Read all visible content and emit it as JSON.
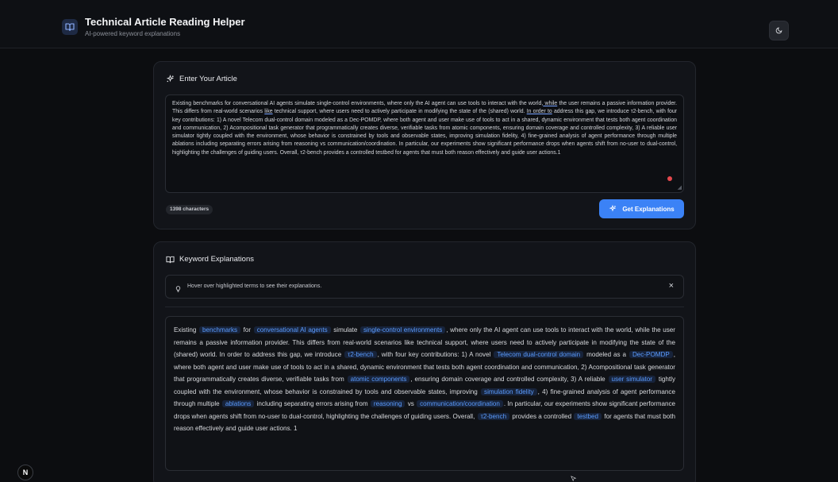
{
  "header": {
    "title": "Technical Article Reading Helper",
    "subtitle": "AI-powered keyword explanations",
    "logo_icon": "book-open-icon",
    "theme_icon": "moon-icon"
  },
  "input_card": {
    "title": "Enter Your Article",
    "title_icon": "sparkles-icon",
    "article": {
      "seg0": "Existing benchmarks for conversational AI agents simulate single-control environments, where only the AI agent can use tools to interact with the world,",
      "ul1": " while",
      "seg1": " the user remains a passive information provider. This differs from real-world scenarios ",
      "ul2": "like",
      "seg2": " technical support, where users need to actively participate in modifying the state of the (shared) world. ",
      "ul3": "In order to",
      "seg3": " address this gap, we introduce τ2-bench, with four key contributions: 1) A novel Telecom dual-control domain modeled as a Dec-POMDP, where both agent and user make use of tools to act in a shared, dynamic environment that tests both agent coordination and communication, 2) Acompositional task generator that programmatically creates diverse, verifiable tasks from atomic components, ensuring domain coverage and controlled complexity, 3) A reliable user simulator tightly coupled with the environment, whose behavior is constrained by tools and observable states, improving simulation fidelity, 4) fine-grained analysis of agent performance through multiple ablations including separating errors arising from reasoning vs communication/coordination. In particular, our experiments show significant performance drops when agents shift from no-user to dual-control, highlighting the challenges of guiding users. Overall, τ2-bench provides a controlled testbed for agents that must both reason effectively and guide user actions.1"
    },
    "char_count": "1398 characters",
    "button_label": "Get Explanations",
    "button_icon": "sparkles-icon"
  },
  "explain_card": {
    "title": "Keyword Explanations",
    "title_icon": "book-open-icon",
    "hint": "Hover over highlighted terms to see their explanations.",
    "hint_icon": "lightbulb-icon",
    "close_label": "×",
    "body": {
      "t0": "Existing",
      "k1": "benchmarks",
      "t1": "for",
      "k2": "conversational AI agents",
      "t2": "simulate",
      "k3": "single-control environments",
      "t3": ", where only the AI agent can use tools to interact with the world, while the user remains a passive information provider. This differs from real-world scenarios like technical support, where users need to actively participate in modifying the state of the (shared) world. In order to address this gap, we introduce",
      "k4": "τ2-bench",
      "t4": ", with four key contributions: 1) A novel",
      "k5": "Telecom dual-control domain",
      "t5": "modeled as a",
      "k6": "Dec-POMDP",
      "t6": ", where both agent and user make use of tools to act in a shared, dynamic environment that tests both agent coordination and communication, 2) Acompositional task generator that programmatically creates diverse, verifiable tasks from",
      "k7": "atomic components",
      "t7": ", ensuring domain coverage and controlled complexity, 3) A reliable",
      "k8": "user simulator",
      "t8": "tightly coupled with the environment, whose behavior is constrained by tools and observable states, improving",
      "k9": "simulation fidelity",
      "t9": ", 4) fine-grained analysis of agent performance through multiple",
      "k10": "ablations",
      "t10": "including separating errors arising from",
      "k11": "reasoning",
      "t11": "vs",
      "k12": "communication/coordination",
      "t12": ". In particular, our experiments show significant performance drops when agents shift from no-user to dual-control, highlighting the challenges of guiding users. Overall,",
      "k13": "τ2-bench",
      "t13": "provides a controlled",
      "k14": "testbed",
      "t14": "for agents that must both reason effectively and guide user actions. 1"
    }
  },
  "devtools_badge": "N"
}
